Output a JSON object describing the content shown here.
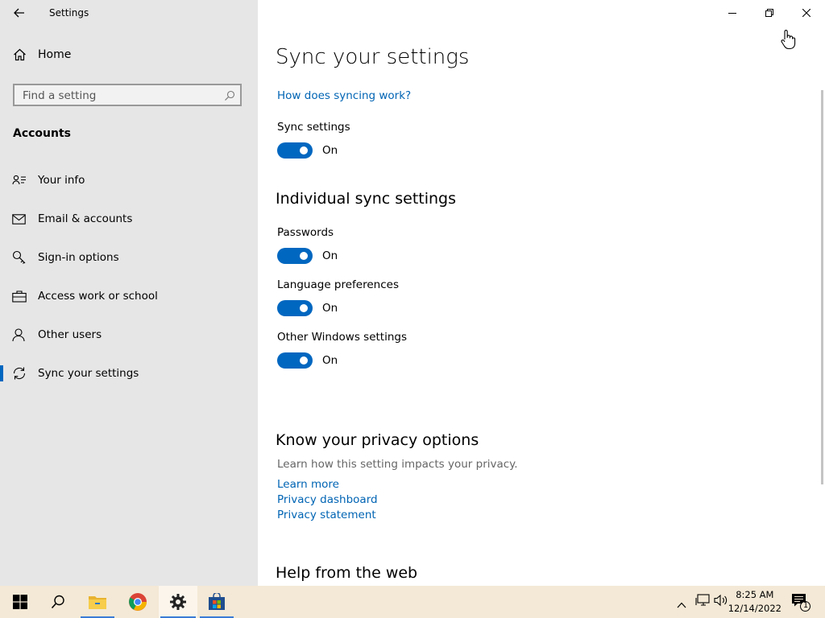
{
  "app": {
    "title": "Settings"
  },
  "sidebar": {
    "home_label": "Home",
    "search_placeholder": "Find a setting",
    "section": "Accounts",
    "items": [
      {
        "label": "Your info",
        "icon": "person-card-icon"
      },
      {
        "label": "Email & accounts",
        "icon": "mail-icon"
      },
      {
        "label": "Sign-in options",
        "icon": "key-icon"
      },
      {
        "label": "Access work or school",
        "icon": "briefcase-icon"
      },
      {
        "label": "Other users",
        "icon": "person-icon"
      },
      {
        "label": "Sync your settings",
        "icon": "sync-icon",
        "selected": true
      }
    ]
  },
  "main": {
    "title": "Sync your settings",
    "how_link": "How does syncing work?",
    "sync_label": "Sync settings",
    "sync_state": "On",
    "individual_heading": "Individual sync settings",
    "individual": [
      {
        "label": "Passwords",
        "state": "On"
      },
      {
        "label": "Language preferences",
        "state": "On"
      },
      {
        "label": "Other Windows settings",
        "state": "On"
      }
    ],
    "privacy_heading": "Know your privacy options",
    "privacy_desc": "Learn how this setting impacts your privacy.",
    "privacy_links": [
      "Learn more",
      "Privacy dashboard",
      "Privacy statement"
    ],
    "help_heading": "Help from the web"
  },
  "taskbar": {
    "time": "8:25 AM",
    "date": "12/14/2022",
    "notification_count": "1"
  },
  "colors": {
    "accent": "#0067c0",
    "link": "#0064b4",
    "taskbar": "#f4e9d6"
  }
}
